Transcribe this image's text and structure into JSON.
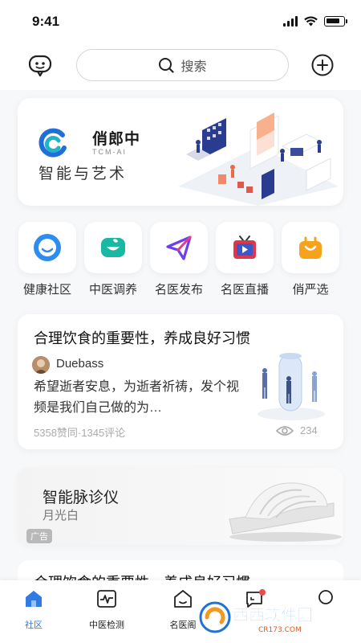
{
  "status": {
    "time": "9:41",
    "battery_level": 0.85
  },
  "search": {
    "placeholder": "搜索"
  },
  "icons": {
    "chat": "chat-bot-icon",
    "search": "search-icon",
    "add": "add-circle-icon"
  },
  "banner": {
    "brand_name": "俏郎中",
    "brand_sub": "TCM-AI",
    "slogan": "智能与艺术"
  },
  "quick_entries": [
    {
      "label": "健康社区",
      "icon": "health-community-icon",
      "color": "#2d8cf0"
    },
    {
      "label": "中医调养",
      "icon": "tcm-care-icon",
      "color": "#19b8a3"
    },
    {
      "label": "名医发布",
      "icon": "doctor-publish-icon",
      "color": "#6c3ef2"
    },
    {
      "label": "名医直播",
      "icon": "doctor-live-icon",
      "color": "#e0364a"
    },
    {
      "label": "俏严选",
      "icon": "shopping-bag-icon",
      "color": "#f7a21b"
    }
  ],
  "post": {
    "title": "合理饮食的重要性，养成良好习惯",
    "author": "Duebass",
    "text": "希望逝者安息，为逝者祈祷，发个视频是我们自己做的为…",
    "likes_comments": "5358赞同·1345评论",
    "views": "234"
  },
  "ad": {
    "title": "智能脉诊仪",
    "subtitle": "月光白",
    "badge": "广告"
  },
  "next_post": {
    "title": "合理饮食的重要性，养成良好习惯"
  },
  "tabs": [
    {
      "label": "社区",
      "icon": "home-icon",
      "active": true
    },
    {
      "label": "中医检测",
      "icon": "pulse-monitor-icon",
      "active": false
    },
    {
      "label": "名医阁",
      "icon": "hall-icon",
      "active": false
    },
    {
      "label": "",
      "icon": "message-icon",
      "active": false
    },
    {
      "label": "",
      "icon": "profile-icon",
      "active": false
    }
  ],
  "watermark": {
    "text": "西西软件园",
    "sub": "CR173.COM"
  },
  "colors": {
    "accent": "#2f7ae5",
    "notify": "#e94b4b"
  }
}
